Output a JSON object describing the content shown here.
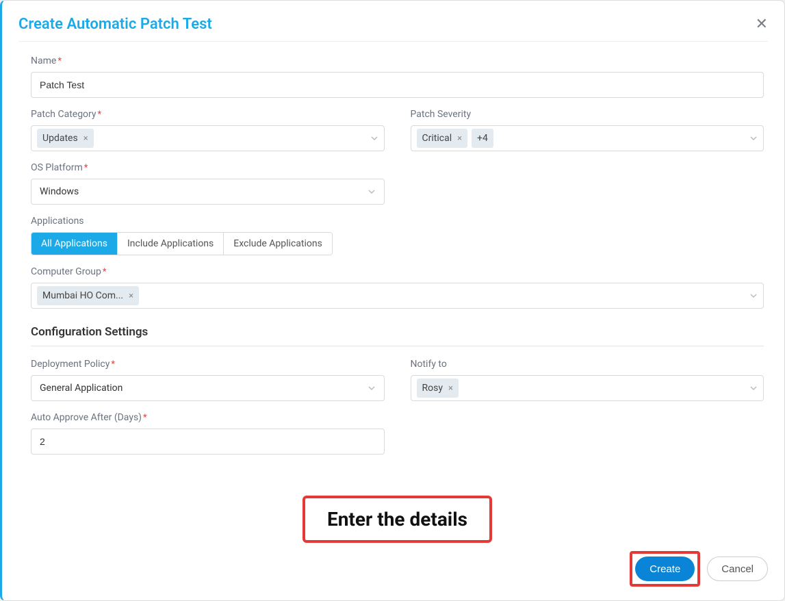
{
  "modal": {
    "title": "Create Automatic Patch Test"
  },
  "labels": {
    "name": "Name",
    "patch_category": "Patch Category",
    "patch_severity": "Patch Severity",
    "os_platform": "OS Platform",
    "applications": "Applications",
    "computer_group": "Computer Group",
    "config_section": "Configuration Settings",
    "deployment_policy": "Deployment Policy",
    "notify_to": "Notify to",
    "auto_approve": "Auto Approve After (Days)"
  },
  "values": {
    "name": "Patch Test",
    "patch_category_tag": "Updates",
    "patch_severity_tag": "Critical",
    "patch_severity_more": "+4",
    "os_platform": "Windows",
    "computer_group_tag": "Mumbai HO Com...",
    "deployment_policy": "General Application",
    "notify_to_tag": "Rosy",
    "auto_approve": "2"
  },
  "tabs": {
    "all": "All Applications",
    "include": "Include Applications",
    "exclude": "Exclude Applications"
  },
  "callout": "Enter the details",
  "buttons": {
    "create": "Create",
    "cancel": "Cancel"
  },
  "glyphs": {
    "required": "*",
    "tag_close": "×",
    "modal_close": "✕"
  }
}
